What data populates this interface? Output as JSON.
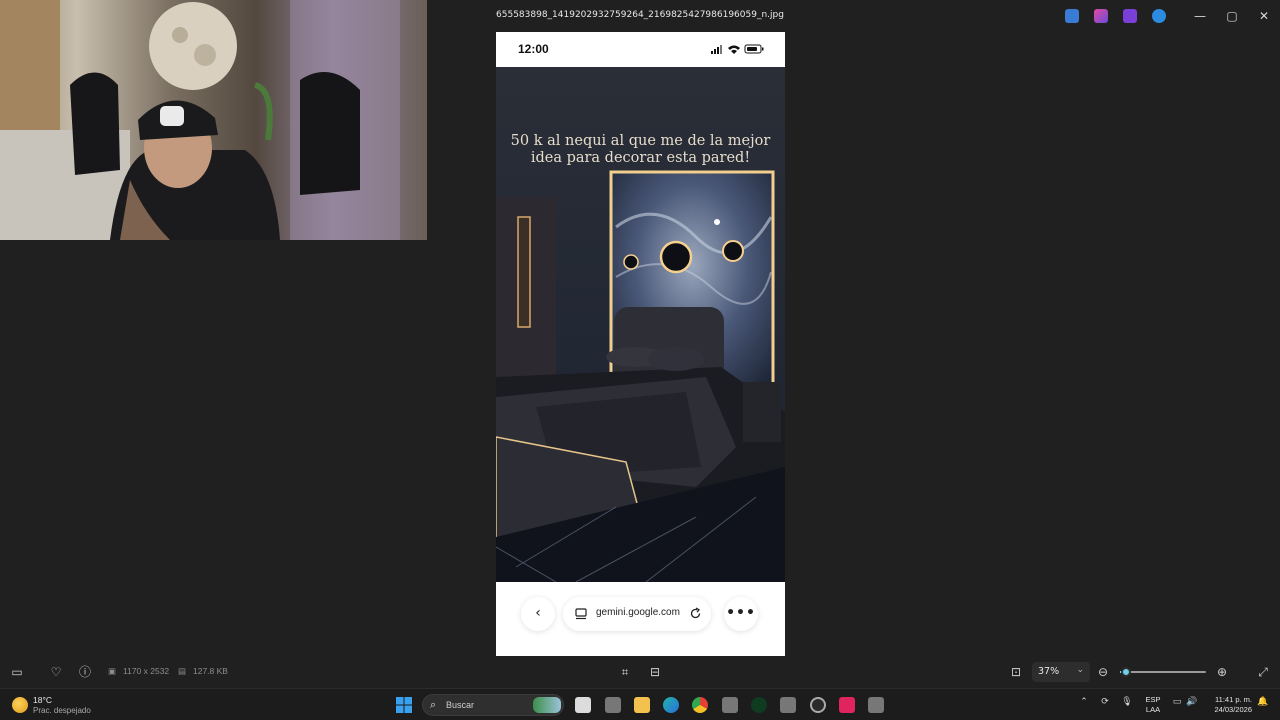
{
  "window": {
    "title": "655583898_1419202932759264_2169825427986196059_n.jpg",
    "controls": {
      "minimize": "—",
      "maximize": "▢",
      "close": "✕"
    }
  },
  "phone": {
    "time": "12:00",
    "caption": "50 k al nequi al que me de la mejor idea para decorar esta pared!",
    "url": "gemini.google.com",
    "back_icon": "chevron-left-icon",
    "reload_icon": "reload-icon",
    "more_icon": "more-dots-icon"
  },
  "viewer": {
    "dimensions": "1170 x 2532",
    "filesize": "127.8 KB",
    "zoom": "37%",
    "zoom_fraction": 0.37
  },
  "taskbar": {
    "temperature": "18°C",
    "weather": "Prac. despejado",
    "search_placeholder": "Buscar",
    "lang_line1": "ESP",
    "lang_line2": "LAA",
    "time": "11:41 p. m.",
    "date": "24/03/2026"
  },
  "colors": {
    "viewer_bg": "#202020",
    "zoom_accent": "#6fd0e6",
    "caption": "#e6dccb"
  }
}
